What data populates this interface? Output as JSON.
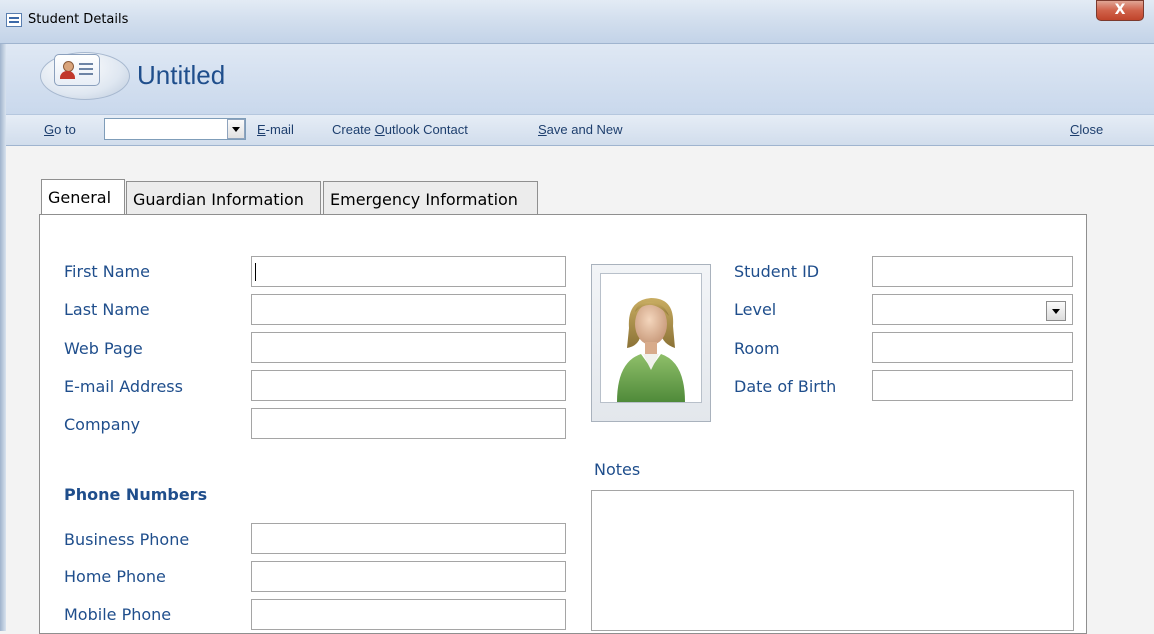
{
  "window": {
    "title": "Student Details",
    "close_glyph": "X"
  },
  "header": {
    "form_title": "Untitled",
    "icon": "contact-card-icon"
  },
  "command_bar": {
    "goto_prefix": "G",
    "goto_rest": "o to",
    "goto_value": "",
    "email_u": "E",
    "email_rest": "-mail",
    "outlook_pre": "Create ",
    "outlook_u": "O",
    "outlook_rest": "utlook Contact",
    "save_u": "S",
    "save_rest": "ave and New",
    "close_u": "C",
    "close_rest": "lose"
  },
  "tabs": [
    {
      "label": "General",
      "active": true
    },
    {
      "label": "Guardian Information",
      "active": false
    },
    {
      "label": "Emergency Information",
      "active": false
    }
  ],
  "left_fields": [
    {
      "label": "First Name",
      "value": ""
    },
    {
      "label": "Last Name",
      "value": ""
    },
    {
      "label": "Web Page",
      "value": ""
    },
    {
      "label": "E-mail Address",
      "value": ""
    },
    {
      "label": "Company",
      "value": ""
    }
  ],
  "phone_section": {
    "heading": "Phone Numbers",
    "fields": [
      {
        "label": "Business Phone",
        "value": ""
      },
      {
        "label": "Home Phone",
        "value": ""
      },
      {
        "label": "Mobile Phone",
        "value": ""
      }
    ]
  },
  "right_fields": [
    {
      "label": "Student ID",
      "value": ""
    },
    {
      "label": "Level",
      "value": ""
    },
    {
      "label": "Room",
      "value": ""
    },
    {
      "label": "Date of Birth",
      "value": ""
    }
  ],
  "notes": {
    "label": "Notes",
    "value": ""
  },
  "colors": {
    "label_blue": "#1f4e8c",
    "header_bg": "#c9d8ec",
    "close_red": "#c0442b"
  }
}
